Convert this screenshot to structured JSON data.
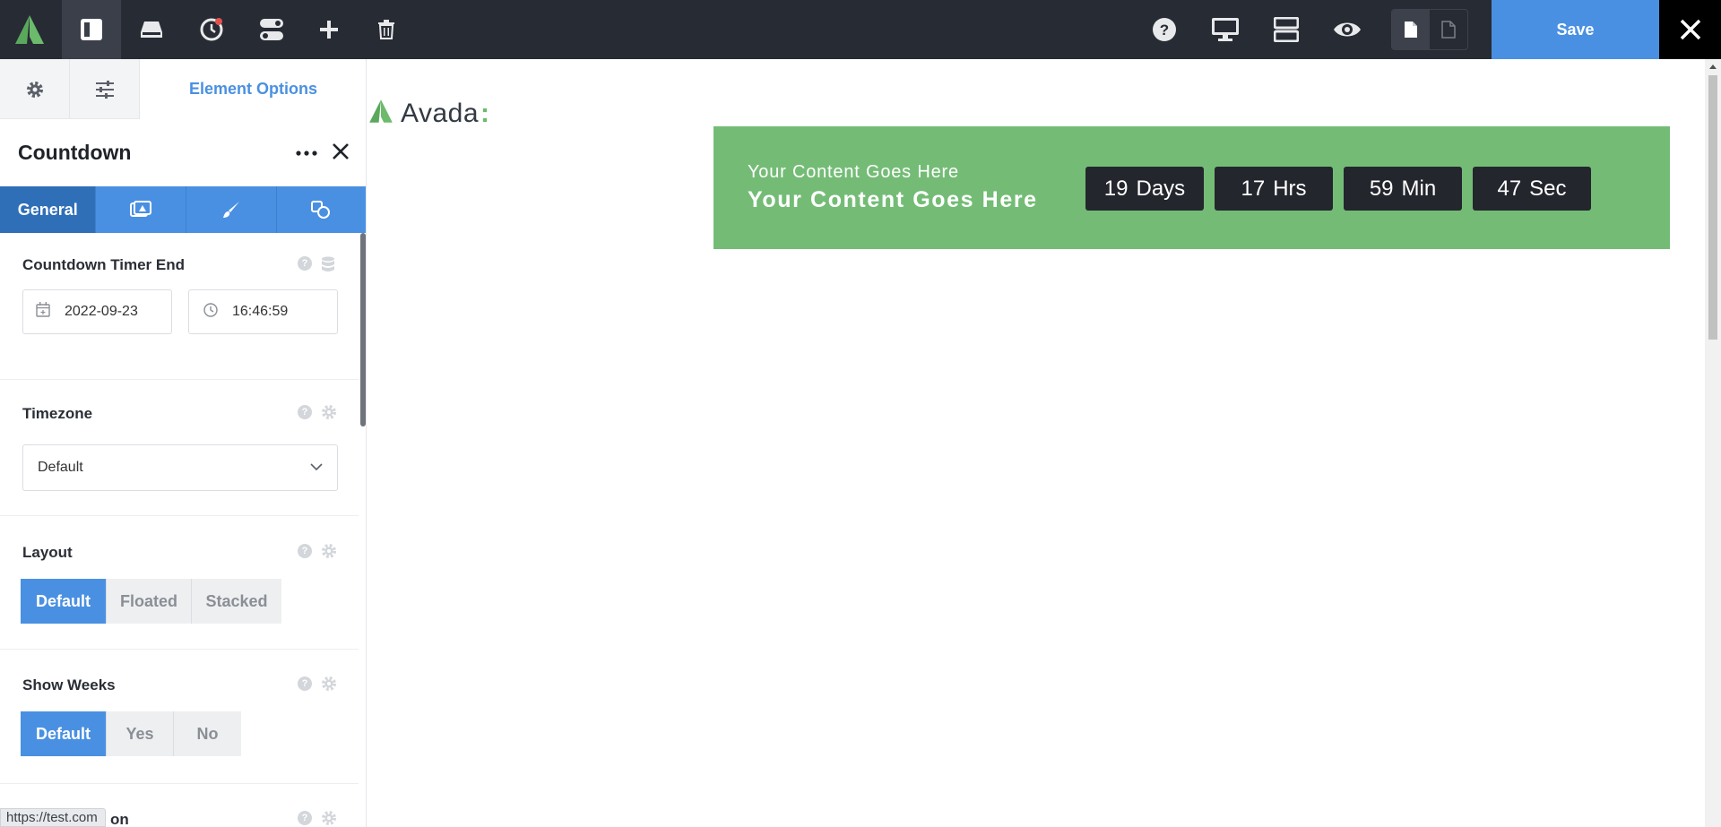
{
  "toolbar": {
    "save_label": "Save",
    "icons": [
      "avada-logo-icon",
      "layout-sidebar-icon",
      "library-icon",
      "history-icon",
      "toggles-icon",
      "plus-icon",
      "trash-icon",
      "help-icon",
      "desktop-icon",
      "sections-icon",
      "preview-eye-icon",
      "page-icon",
      "page-outline-icon",
      "close-icon"
    ],
    "colors": {
      "bar": "#272b34",
      "save": "#4a90e2",
      "close": "#000000"
    }
  },
  "sidebar": {
    "header_tab_title": "Element Options",
    "element_name": "Countdown",
    "sub_tabs": {
      "general_label": "General"
    },
    "options": {
      "countdown_timer_end": {
        "label": "Countdown Timer End",
        "date": "2022-09-23",
        "time": "16:46:59"
      },
      "timezone": {
        "label": "Timezone",
        "selected": "Default"
      },
      "layout": {
        "label": "Layout",
        "options": [
          "Default",
          "Floated",
          "Stacked"
        ],
        "selected": "Default"
      },
      "show_weeks": {
        "label": "Show Weeks",
        "options": [
          "Default",
          "Yes",
          "No"
        ],
        "selected": "Default"
      },
      "next_label_partial": "on"
    }
  },
  "status_bar": {
    "url": "https://test.com"
  },
  "canvas": {
    "brand_text": "Avada",
    "brand_colon": ":",
    "banner": {
      "subtitle": "Your Content Goes Here",
      "title": "Your Content Goes Here",
      "color": "#74bc76",
      "countdown": [
        {
          "num": "19",
          "unit": "Days"
        },
        {
          "num": "17",
          "unit": "Hrs"
        },
        {
          "num": "59",
          "unit": "Min"
        },
        {
          "num": "47",
          "unit": "Sec"
        }
      ]
    }
  }
}
